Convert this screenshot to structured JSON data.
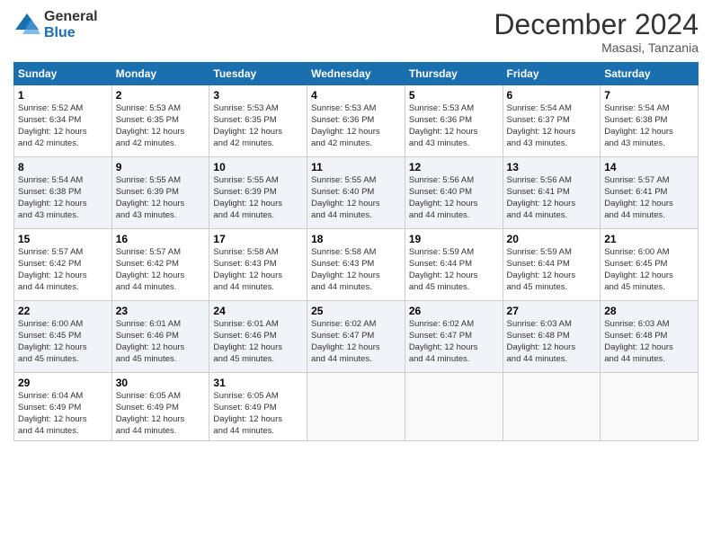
{
  "logo": {
    "general": "General",
    "blue": "Blue"
  },
  "title": "December 2024",
  "location": "Masasi, Tanzania",
  "headers": [
    "Sunday",
    "Monday",
    "Tuesday",
    "Wednesday",
    "Thursday",
    "Friday",
    "Saturday"
  ],
  "weeks": [
    [
      {
        "day": "1",
        "sunrise": "5:52 AM",
        "sunset": "6:34 PM",
        "daylight": "12 hours and 42 minutes."
      },
      {
        "day": "2",
        "sunrise": "5:53 AM",
        "sunset": "6:35 PM",
        "daylight": "12 hours and 42 minutes."
      },
      {
        "day": "3",
        "sunrise": "5:53 AM",
        "sunset": "6:35 PM",
        "daylight": "12 hours and 42 minutes."
      },
      {
        "day": "4",
        "sunrise": "5:53 AM",
        "sunset": "6:36 PM",
        "daylight": "12 hours and 42 minutes."
      },
      {
        "day": "5",
        "sunrise": "5:53 AM",
        "sunset": "6:36 PM",
        "daylight": "12 hours and 43 minutes."
      },
      {
        "day": "6",
        "sunrise": "5:54 AM",
        "sunset": "6:37 PM",
        "daylight": "12 hours and 43 minutes."
      },
      {
        "day": "7",
        "sunrise": "5:54 AM",
        "sunset": "6:38 PM",
        "daylight": "12 hours and 43 minutes."
      }
    ],
    [
      {
        "day": "8",
        "sunrise": "5:54 AM",
        "sunset": "6:38 PM",
        "daylight": "12 hours and 43 minutes."
      },
      {
        "day": "9",
        "sunrise": "5:55 AM",
        "sunset": "6:39 PM",
        "daylight": "12 hours and 43 minutes."
      },
      {
        "day": "10",
        "sunrise": "5:55 AM",
        "sunset": "6:39 PM",
        "daylight": "12 hours and 44 minutes."
      },
      {
        "day": "11",
        "sunrise": "5:55 AM",
        "sunset": "6:40 PM",
        "daylight": "12 hours and 44 minutes."
      },
      {
        "day": "12",
        "sunrise": "5:56 AM",
        "sunset": "6:40 PM",
        "daylight": "12 hours and 44 minutes."
      },
      {
        "day": "13",
        "sunrise": "5:56 AM",
        "sunset": "6:41 PM",
        "daylight": "12 hours and 44 minutes."
      },
      {
        "day": "14",
        "sunrise": "5:57 AM",
        "sunset": "6:41 PM",
        "daylight": "12 hours and 44 minutes."
      }
    ],
    [
      {
        "day": "15",
        "sunrise": "5:57 AM",
        "sunset": "6:42 PM",
        "daylight": "12 hours and 44 minutes."
      },
      {
        "day": "16",
        "sunrise": "5:57 AM",
        "sunset": "6:42 PM",
        "daylight": "12 hours and 44 minutes."
      },
      {
        "day": "17",
        "sunrise": "5:58 AM",
        "sunset": "6:43 PM",
        "daylight": "12 hours and 44 minutes."
      },
      {
        "day": "18",
        "sunrise": "5:58 AM",
        "sunset": "6:43 PM",
        "daylight": "12 hours and 44 minutes."
      },
      {
        "day": "19",
        "sunrise": "5:59 AM",
        "sunset": "6:44 PM",
        "daylight": "12 hours and 45 minutes."
      },
      {
        "day": "20",
        "sunrise": "5:59 AM",
        "sunset": "6:44 PM",
        "daylight": "12 hours and 45 minutes."
      },
      {
        "day": "21",
        "sunrise": "6:00 AM",
        "sunset": "6:45 PM",
        "daylight": "12 hours and 45 minutes."
      }
    ],
    [
      {
        "day": "22",
        "sunrise": "6:00 AM",
        "sunset": "6:45 PM",
        "daylight": "12 hours and 45 minutes."
      },
      {
        "day": "23",
        "sunrise": "6:01 AM",
        "sunset": "6:46 PM",
        "daylight": "12 hours and 45 minutes."
      },
      {
        "day": "24",
        "sunrise": "6:01 AM",
        "sunset": "6:46 PM",
        "daylight": "12 hours and 45 minutes."
      },
      {
        "day": "25",
        "sunrise": "6:02 AM",
        "sunset": "6:47 PM",
        "daylight": "12 hours and 44 minutes."
      },
      {
        "day": "26",
        "sunrise": "6:02 AM",
        "sunset": "6:47 PM",
        "daylight": "12 hours and 44 minutes."
      },
      {
        "day": "27",
        "sunrise": "6:03 AM",
        "sunset": "6:48 PM",
        "daylight": "12 hours and 44 minutes."
      },
      {
        "day": "28",
        "sunrise": "6:03 AM",
        "sunset": "6:48 PM",
        "daylight": "12 hours and 44 minutes."
      }
    ],
    [
      {
        "day": "29",
        "sunrise": "6:04 AM",
        "sunset": "6:49 PM",
        "daylight": "12 hours and 44 minutes."
      },
      {
        "day": "30",
        "sunrise": "6:05 AM",
        "sunset": "6:49 PM",
        "daylight": "12 hours and 44 minutes."
      },
      {
        "day": "31",
        "sunrise": "6:05 AM",
        "sunset": "6:49 PM",
        "daylight": "12 hours and 44 minutes."
      },
      null,
      null,
      null,
      null
    ]
  ]
}
